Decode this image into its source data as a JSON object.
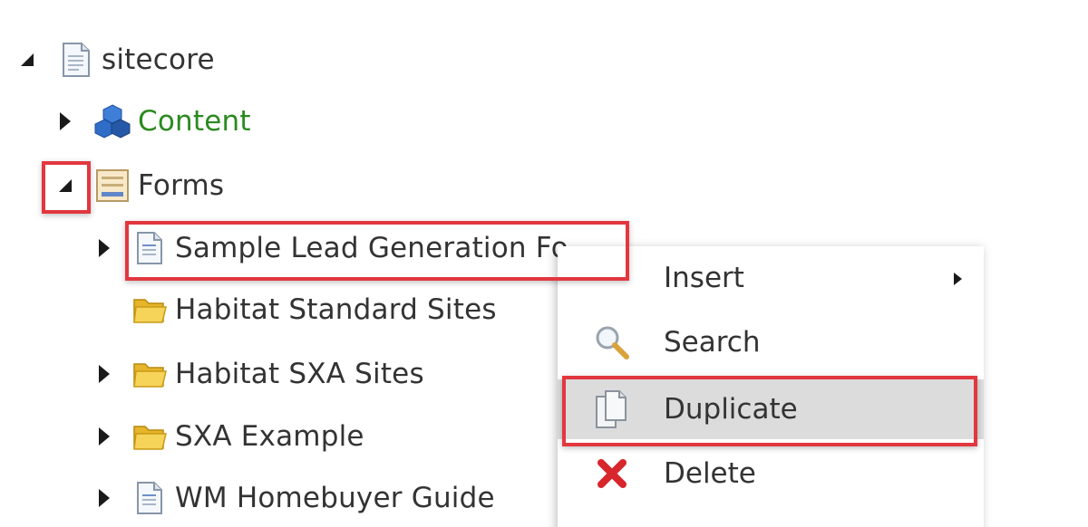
{
  "tree": {
    "root": {
      "label": "sitecore",
      "icon": "page-icon",
      "expanded": true
    },
    "content": {
      "label": "Content",
      "icon": "cubes-icon",
      "color": "#2b8a1f"
    },
    "forms": {
      "label": "Forms",
      "icon": "forms-icon",
      "expanded": true
    },
    "children": [
      {
        "label": "Sample Lead Generation Fo…",
        "icon": "form-doc-icon",
        "has_children": true
      },
      {
        "label": "Habitat Standard Sites",
        "icon": "folder-icon",
        "has_children": false
      },
      {
        "label": "Habitat SXA Sites",
        "icon": "folder-icon",
        "has_children": true
      },
      {
        "label": "SXA Example",
        "icon": "folder-icon",
        "has_children": true
      },
      {
        "label": "WM Homebuyer Guide",
        "icon": "form-doc-icon",
        "has_children": true
      }
    ]
  },
  "context_menu": {
    "items": [
      {
        "label": "Insert",
        "icon": "",
        "submenu": true
      },
      {
        "label": "Search",
        "icon": "magnifier-icon"
      },
      {
        "label": "Duplicate",
        "icon": "duplicate-icon",
        "active": true
      },
      {
        "label": "Delete",
        "icon": "delete-x-icon"
      }
    ]
  },
  "colors": {
    "highlight": "#e2373f",
    "content_label": "#2b8a1f",
    "menu_active_bg": "#dcdcdc"
  }
}
